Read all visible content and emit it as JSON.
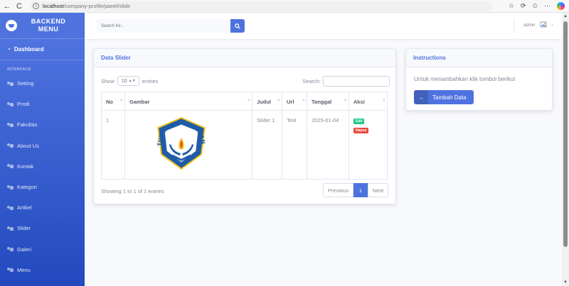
{
  "browser": {
    "back": "←",
    "reload": "C",
    "url_host": "localhost",
    "url_path": "/company-profile/panel/slide"
  },
  "sidebar": {
    "brand": "BACKEND\nMENU",
    "dashboard": "Dashboard",
    "heading": "INTERFACE",
    "items": [
      {
        "label": "Setting"
      },
      {
        "label": "Prodi"
      },
      {
        "label": "Fakultas"
      },
      {
        "label": "About Us"
      },
      {
        "label": "Kontak"
      },
      {
        "label": "Kategori"
      },
      {
        "label": "Artikel"
      },
      {
        "label": "Slider"
      },
      {
        "label": "Galeri"
      },
      {
        "label": "Menu"
      }
    ]
  },
  "topbar": {
    "search_placeholder": "Search for...",
    "user": "admin"
  },
  "main": {
    "title": "Data Slider",
    "show": "Show",
    "entries_count": "10",
    "entries": "entries",
    "search_label": "Search:",
    "columns": [
      "No",
      "Gambar",
      "Judul",
      "Url",
      "Tanggal",
      "Aksi"
    ],
    "rows": [
      {
        "no": "1",
        "judul": "Slider 1",
        "url": "Test",
        "tanggal": "2025-01-04",
        "logo_text": "TUT WURI HANDAYANI"
      }
    ],
    "edit": "Edit",
    "hapus": "Hapus",
    "info": "Showing 1 to 1 of 1 entries",
    "prev": "Previous",
    "page": "1",
    "next": "Next"
  },
  "instructions": {
    "title": "Instructions",
    "text": "Untuk menambahkan klik tombol berikut",
    "button": "Tambah Data"
  },
  "colors": {
    "primary": "#4e73df",
    "success": "#1cc88a",
    "danger": "#e74a3b",
    "logo_blue": "#1f5ca8",
    "logo_yellow": "#f6c01a"
  }
}
